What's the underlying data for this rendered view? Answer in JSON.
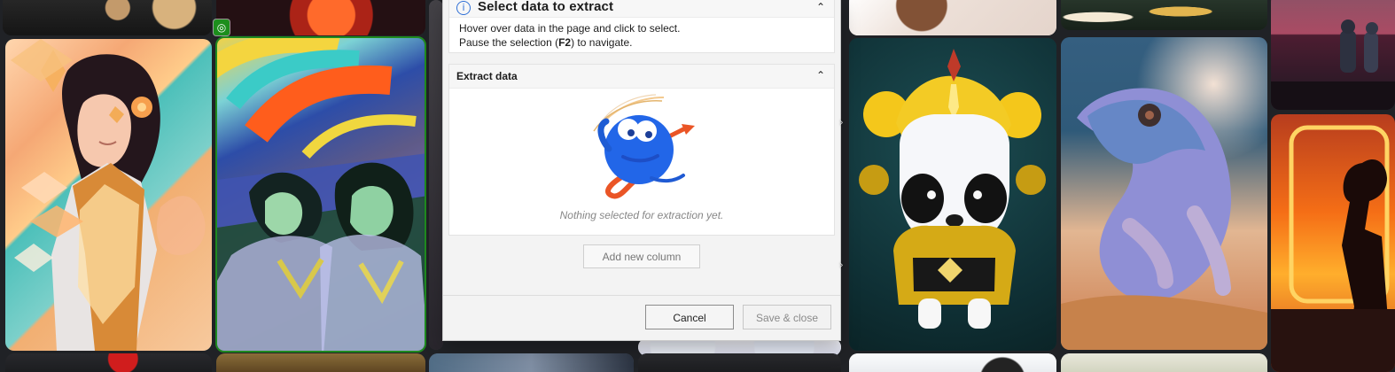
{
  "dialog": {
    "title": "Select data to extract",
    "instructions_line1": "Hover over data in the page and click to select.",
    "instructions_line2_prefix": "Pause the selection (",
    "instructions_key": "F2",
    "instructions_line2_suffix": ") to navigate."
  },
  "extract_section": {
    "title": "Extract data",
    "empty_message": "Nothing selected for extraction yet.",
    "add_column_label": "Add new column"
  },
  "footer": {
    "cancel_label": "Cancel",
    "save_close_label": "Save & close"
  },
  "icons": {
    "info": "info-icon",
    "collapse": "chevron-up-icon",
    "selected": "target-icon",
    "scroll_hint": "chevron-right-icon"
  },
  "colors": {
    "selection_green": "#1f8a1f",
    "dialog_accent": "#2f6fd6",
    "illustration_blue": "#2266e8",
    "illustration_orange": "#ea5526"
  }
}
